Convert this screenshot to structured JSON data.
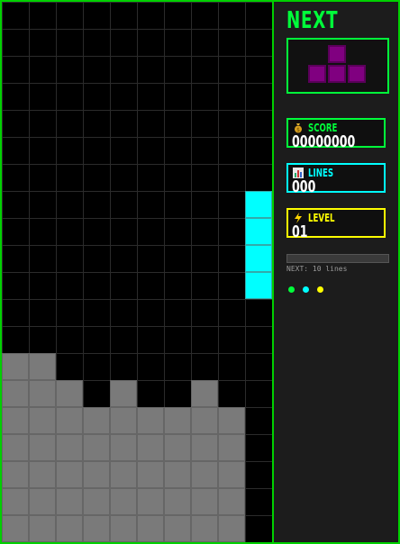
{
  "panel": {
    "next_label": "NEXT",
    "score_label": "SCORE",
    "score_value": "00000000",
    "lines_label": "LINES",
    "lines_value": "000",
    "level_label": "LEVEL",
    "level_value": "01",
    "next_lines_text": "NEXT: 10 lines",
    "progress_fraction": 0
  },
  "colors": {
    "accent": "#00ff3a",
    "cyan": "#00ffff",
    "yellow": "#ffff00",
    "piece_t": "#800080",
    "locked": "#7a7a7a",
    "board_bg": "#000000"
  },
  "icons": {
    "score": "money-bag-icon",
    "lines": "bar-chart-icon",
    "level": "lightning-icon"
  },
  "board": {
    "columns": 10,
    "rows": 20,
    "active_piece": {
      "type": "I",
      "color": "cyan",
      "cells": [
        [
          9,
          7
        ],
        [
          9,
          8
        ],
        [
          9,
          9
        ],
        [
          9,
          10
        ]
      ]
    },
    "locked_cells": [
      [
        0,
        13
      ],
      [
        1,
        13
      ],
      [
        0,
        14
      ],
      [
        1,
        14
      ],
      [
        2,
        14
      ],
      [
        4,
        14
      ],
      [
        7,
        14
      ],
      [
        0,
        15
      ],
      [
        1,
        15
      ],
      [
        2,
        15
      ],
      [
        3,
        15
      ],
      [
        4,
        15
      ],
      [
        5,
        15
      ],
      [
        6,
        15
      ],
      [
        7,
        15
      ],
      [
        8,
        15
      ],
      [
        0,
        16
      ],
      [
        1,
        16
      ],
      [
        2,
        16
      ],
      [
        3,
        16
      ],
      [
        4,
        16
      ],
      [
        5,
        16
      ],
      [
        6,
        16
      ],
      [
        7,
        16
      ],
      [
        8,
        16
      ],
      [
        0,
        17
      ],
      [
        1,
        17
      ],
      [
        2,
        17
      ],
      [
        3,
        17
      ],
      [
        4,
        17
      ],
      [
        5,
        17
      ],
      [
        6,
        17
      ],
      [
        7,
        17
      ],
      [
        8,
        17
      ],
      [
        0,
        18
      ],
      [
        1,
        18
      ],
      [
        2,
        18
      ],
      [
        3,
        18
      ],
      [
        4,
        18
      ],
      [
        5,
        18
      ],
      [
        6,
        18
      ],
      [
        7,
        18
      ],
      [
        8,
        18
      ],
      [
        0,
        19
      ],
      [
        1,
        19
      ],
      [
        2,
        19
      ],
      [
        3,
        19
      ],
      [
        4,
        19
      ],
      [
        5,
        19
      ],
      [
        6,
        19
      ],
      [
        7,
        19
      ],
      [
        8,
        19
      ]
    ]
  },
  "next_piece": {
    "type": "T",
    "color": "purple",
    "cells": [
      [
        1,
        0
      ],
      [
        0,
        1
      ],
      [
        1,
        1
      ],
      [
        2,
        1
      ]
    ]
  },
  "status_dots": [
    "#00ff3a",
    "#00ffff",
    "#ffff00"
  ]
}
